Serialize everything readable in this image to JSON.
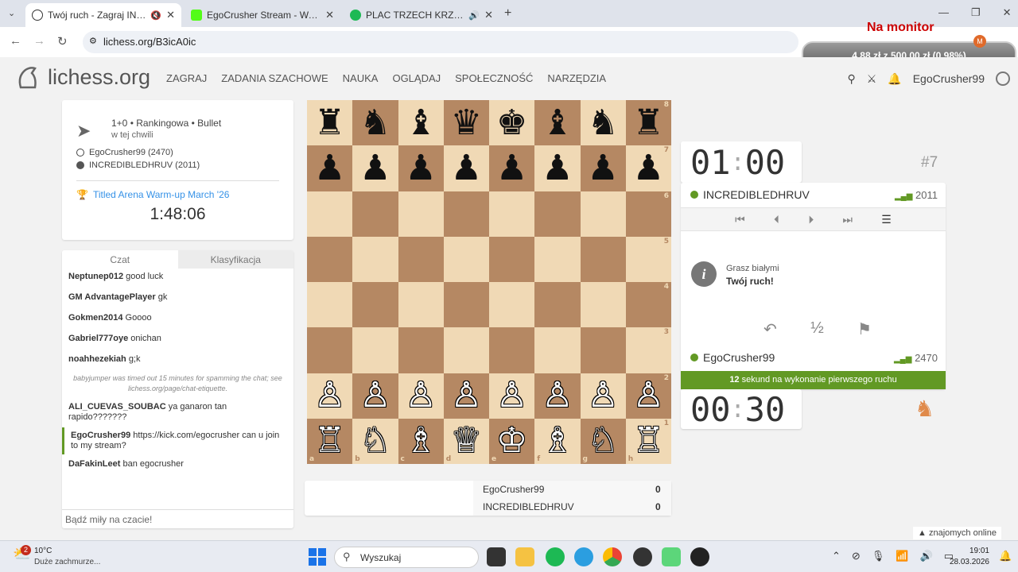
{
  "browser": {
    "tabs": [
      {
        "title": "Twój ruch - Zagraj INCREDI...",
        "active": true,
        "color": "#333333"
      },
      {
        "title": "EgoCrusher Stream - Watch Liv...",
        "active": false,
        "color": "#53fc18"
      },
      {
        "title": "PLAC TRZECH KRZYŻY • Tac...",
        "active": false,
        "color": "#1db954"
      }
    ],
    "url": "lichess.org/B3icA0ic",
    "overlay_title": "Na monitor",
    "overlay_stats": "4,88 zł z 500,00 zł (0.98%)"
  },
  "site": {
    "logo": "lichess.org",
    "menu": [
      "ZAGRAJ",
      "ZADANIA SZACHOWE",
      "NAUKA",
      "OGLĄDAJ",
      "SPOŁECZNOŚĆ",
      "NARZĘDZIA"
    ],
    "username": "EgoCrusher99"
  },
  "game": {
    "mode": "1+0 • Rankingowa • Bullet",
    "when": "w tej chwili",
    "white": "EgoCrusher99 (2470)",
    "black": "INCREDIBLEDHRUV (2011)",
    "tournament": "Titled Arena Warm-up March '26",
    "tournament_clock": "1:48:06"
  },
  "chat": {
    "tabs": [
      "Czat",
      "Klasyfikacja"
    ],
    "messages": [
      {
        "user": "Neptunep012",
        "text": "good luck"
      },
      {
        "user": "GM AdvantagePlayer",
        "text": "gk"
      },
      {
        "user": "Gokmen2014",
        "text": "Goooo"
      },
      {
        "user": "Gabriel777oye",
        "text": "onichan"
      },
      {
        "user": "noahhezekiah",
        "text": "g;k"
      },
      {
        "user": "",
        "text": "babyjumper was timed out 15 minutes for spamming the chat; see lichess.org/page/chat-etiquette."
      },
      {
        "user": "ALI_CUEVAS_SOUBAC",
        "text": "ya ganaron tan rapido???????"
      },
      {
        "user": "EgoCrusher99",
        "text": "https://kick.com/egocrusher can u join to my stream?"
      },
      {
        "user": "DaFakinLeet",
        "text": "ban egocrusher"
      }
    ],
    "placeholder": "Bądź miły na czacie!"
  },
  "board": {
    "ranks": [
      [
        "♜",
        "♞",
        "♝",
        "♛",
        "♚",
        "♝",
        "♞",
        "♜"
      ],
      [
        "♟",
        "♟",
        "♟",
        "♟",
        "♟",
        "♟",
        "♟",
        "♟"
      ],
      [
        "",
        "",
        "",
        "",
        "",
        "",
        "",
        ""
      ],
      [
        "",
        "",
        "",
        "",
        "",
        "",
        "",
        ""
      ],
      [
        "",
        "",
        "",
        "",
        "",
        "",
        "",
        ""
      ],
      [
        "",
        "",
        "",
        "",
        "",
        "",
        "",
        ""
      ],
      [
        "♙",
        "♙",
        "♙",
        "♙",
        "♙",
        "♙",
        "♙",
        "♙"
      ],
      [
        "♖",
        "♘",
        "♗",
        "♕",
        "♔",
        "♗",
        "♘",
        "♖"
      ]
    ],
    "files": [
      "a",
      "b",
      "c",
      "d",
      "e",
      "f",
      "g",
      "h"
    ],
    "rank_labels": [
      "8",
      "7",
      "6",
      "5",
      "4",
      "3",
      "2",
      "1"
    ]
  },
  "scoreboard": [
    {
      "name": "EgoCrusher99",
      "score": "0"
    },
    {
      "name": "INCREDIBLEDHRUV",
      "score": "0"
    }
  ],
  "right": {
    "opp_clock_min": "01",
    "opp_clock_sec": "00",
    "rank_badge": "#7",
    "opponent": "INCREDIBLEDHRUV",
    "opponent_rating": "2011",
    "info_line1": "Grasz białymi",
    "info_line2": "Twój ruch!",
    "draw_symbol": "½",
    "player": "EgoCrusher99",
    "player_rating": "2470",
    "timer_bold": "12",
    "timer_text": "sekund na wykonanie pierwszego ruchu",
    "my_clock_min": "00",
    "my_clock_sec": "30",
    "friends": "znajomych online"
  },
  "taskbar": {
    "weather_temp": "10°C",
    "weather_text": "Duże zachmurze...",
    "search": "Wyszukaj",
    "time": "19:01",
    "date": "28.03.2026"
  }
}
